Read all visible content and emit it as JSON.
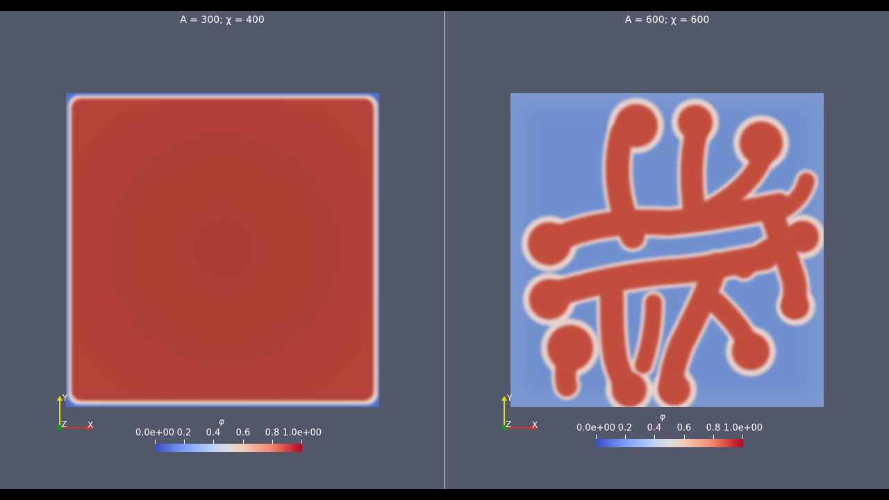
{
  "left_view": {
    "title": "A = 300; χ = 400",
    "colorbar": {
      "title": "φ",
      "labels": [
        "0.0e+00",
        "0.2",
        "0.4",
        "0.6",
        "0.8",
        "1.0e+00"
      ]
    },
    "axes": {
      "y": "Y",
      "z": "Z",
      "x": "X"
    }
  },
  "right_view": {
    "title": "A = 600; χ = 600",
    "colorbar": {
      "title": "φ",
      "labels": [
        "0.0e+00",
        "0.2",
        "0.4",
        "0.6",
        "0.8",
        "1.0e+00"
      ]
    },
    "axes": {
      "y": "Y",
      "z": "Z",
      "x": "X"
    }
  },
  "colors": {
    "background": "#525769",
    "phase_high": "#b5433a",
    "phase_low": "#6f8fce",
    "interface": "#e8d2c8",
    "divider": "#e8e8ee"
  }
}
